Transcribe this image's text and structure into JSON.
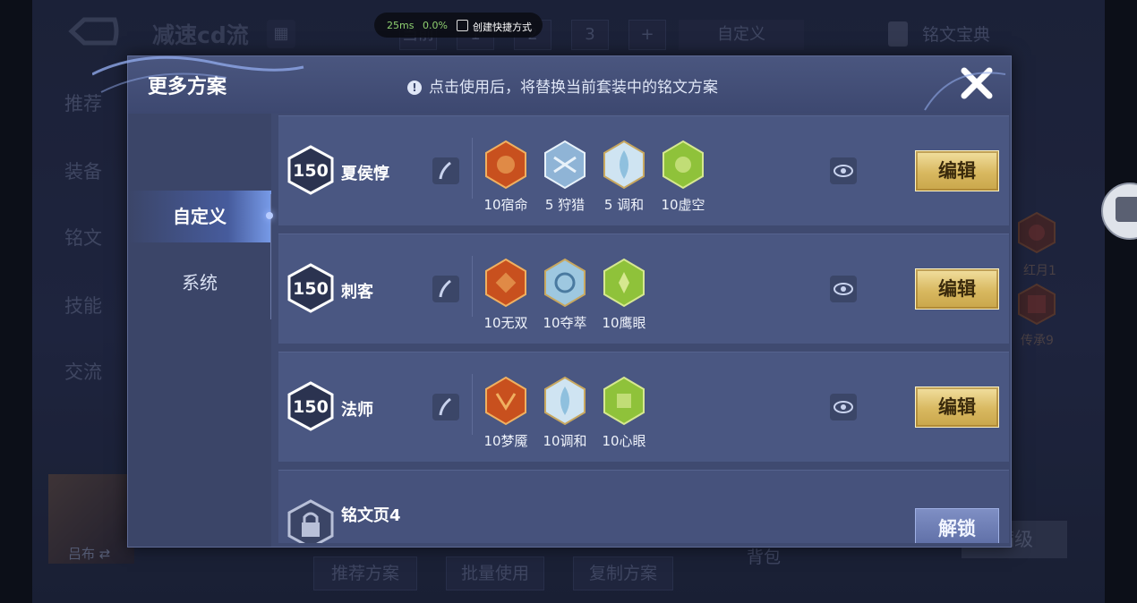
{
  "hud": {
    "latency": "25ms",
    "loss": "0.0%",
    "shortcut": "创建快捷方式"
  },
  "background": {
    "title": "减速cd流",
    "top_tabs": [
      "当前",
      "1",
      "2",
      "3",
      "+"
    ],
    "custom_label": "自定义",
    "rune_book": "铭文宝典",
    "side_nav": [
      "推荐",
      "装备",
      "铭文",
      "技能",
      "交流"
    ],
    "hero_name": "吕布",
    "bottom_buttons": [
      "推荐方案",
      "批量使用",
      "复制方案"
    ],
    "backpack": "背包",
    "max_level": "满级",
    "right_runes": [
      "红月1",
      "传承9"
    ]
  },
  "modal": {
    "title": "更多方案",
    "hint": "点击使用后，将替换当前套装中的铭文方案",
    "tabs": [
      {
        "label": "自定义",
        "active": true
      },
      {
        "label": "系统",
        "active": false
      }
    ],
    "rows": [
      {
        "level": "150",
        "name": "夏侯惇",
        "runes": [
          {
            "label": "10宿命",
            "color": "#c8501e"
          },
          {
            "label": "5 狩猎",
            "color": "#8fb4d6"
          },
          {
            "label": "5 调和",
            "color": "#cfe4f2"
          },
          {
            "label": "10虚空",
            "color": "#8fc23a"
          }
        ],
        "action": "编辑"
      },
      {
        "level": "150",
        "name": "刺客",
        "runes": [
          {
            "label": "10无双",
            "color": "#c8501e"
          },
          {
            "label": "10夺萃",
            "color": "#9ec8e0"
          },
          {
            "label": "10鹰眼",
            "color": "#8fc23a"
          }
        ],
        "action": "编辑"
      },
      {
        "level": "150",
        "name": "法师",
        "runes": [
          {
            "label": "10梦魇",
            "color": "#c8501e"
          },
          {
            "label": "10调和",
            "color": "#cfe4f2"
          },
          {
            "label": "10心眼",
            "color": "#8fc23a"
          }
        ],
        "action": "编辑"
      },
      {
        "locked": true,
        "name": "铭文页4",
        "action": "解锁"
      }
    ]
  }
}
